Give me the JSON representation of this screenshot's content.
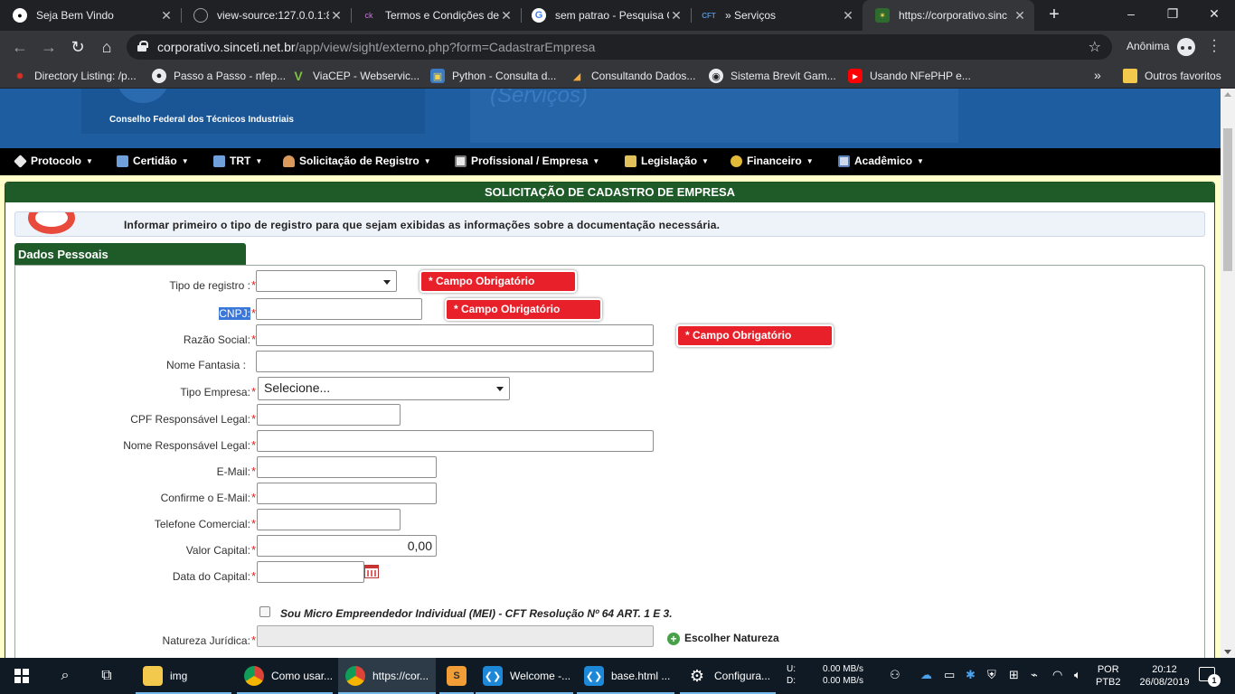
{
  "browser": {
    "tabs": [
      {
        "title": "Seja Bem Vindo",
        "icon": "github-icon"
      },
      {
        "title": "view-source:127.0.0.1:8",
        "icon": "globe-icon"
      },
      {
        "title": "Termos e Condições de",
        "icon": "site-icon"
      },
      {
        "title": "sem patrao - Pesquisa G",
        "icon": "google-icon"
      },
      {
        "title": "» Serviços",
        "icon": "cft-icon"
      },
      {
        "title": "https://corporativo.sinc",
        "icon": "cft-seal-icon"
      }
    ],
    "url_host": "corporativo.sinceti.net.br",
    "url_path": "/app/view/sight/externo.php?form=CadastrarEmpresa",
    "profile_label": "Anônima",
    "bookmarks": [
      "Directory Listing: /p...",
      "Passo a Passo - nfep...",
      "ViaCEP - Webservic...",
      "Python - Consulta d...",
      "Consultando Dados...",
      "Sistema Brevit Gam...",
      "Usando NFePHP e..."
    ],
    "bookmarks_more": "»",
    "other_bookmarks": "Outros favoritos"
  },
  "site": {
    "brand_line": "Conselho Federal dos Técnicos Industriais",
    "header_sub": "(Serviços)",
    "nav": [
      "Protocolo",
      "Certidão",
      "TRT",
      "Solicitação de Registro",
      "Profissional / Empresa",
      "Legislação",
      "Financeiro",
      "Acadêmico"
    ]
  },
  "form": {
    "panel_title": "SOLICITAÇÃO DE CADASTRO DE EMPRESA",
    "info_text": "Informar primeiro o tipo de registro para que sejam exibidas as informações sobre a documentação necessária.",
    "section_title": "Dados Pessoais",
    "required_marker": "*",
    "error_text": "* Campo Obrigatório",
    "labels": {
      "tipo_registro": "Tipo de registro :",
      "cnpj": "CNPJ:",
      "razao_social": "Razão Social:",
      "nome_fantasia": "Nome Fantasia :",
      "tipo_empresa": "Tipo Empresa:",
      "cpf_responsavel": "CPF Responsável Legal:",
      "nome_responsavel": "Nome Responsável Legal:",
      "email": "E-Mail:",
      "confirme_email": "Confirme o E-Mail:",
      "telefone": "Telefone Comercial:",
      "valor_capital": "Valor Capital:",
      "data_capital": "Data do Capital:",
      "natureza": "Natureza Jurídica:"
    },
    "values": {
      "tipo_registro": "",
      "cnpj": "",
      "razao_social": "",
      "nome_fantasia": "",
      "tipo_empresa": "Selecione...",
      "cpf_responsavel": "",
      "nome_responsavel": "",
      "email": "",
      "confirme_email": "",
      "telefone": "",
      "valor_capital": "0,00",
      "data_capital": "",
      "natureza": ""
    },
    "mei_label": "Sou Micro Empreendedor Individual (MEI) - CFT Resolução Nº 64 ART. 1 E 3.",
    "choose_natureza": "Escolher Natureza"
  },
  "taskbar": {
    "apps": [
      {
        "label": "img",
        "icon": "folder-icon"
      },
      {
        "label": "Como usar...",
        "icon": "chrome-icon"
      },
      {
        "label": "https://cor...",
        "icon": "chrome-icon"
      },
      {
        "label": "",
        "icon": "sublime-icon"
      },
      {
        "label": "Welcome -...",
        "icon": "vscode-icon"
      },
      {
        "label": "base.html ...",
        "icon": "vscode-icon"
      },
      {
        "label": "Configura...",
        "icon": "gear-icon"
      }
    ],
    "net_up_label": "U:",
    "net_down_label": "D:",
    "net_up": "0.00 MB/s",
    "net_down": "0.00 MB/s",
    "lang": "POR",
    "layout": "PTB2",
    "time": "20:12",
    "date": "26/08/2019",
    "notifications": "1"
  },
  "colors": {
    "page_bg": "#ffffc9",
    "header_blue": "#1e5ea0",
    "panel_green": "#1f5a29",
    "error_red": "#e8202a",
    "required_red": "#e01f1f"
  }
}
